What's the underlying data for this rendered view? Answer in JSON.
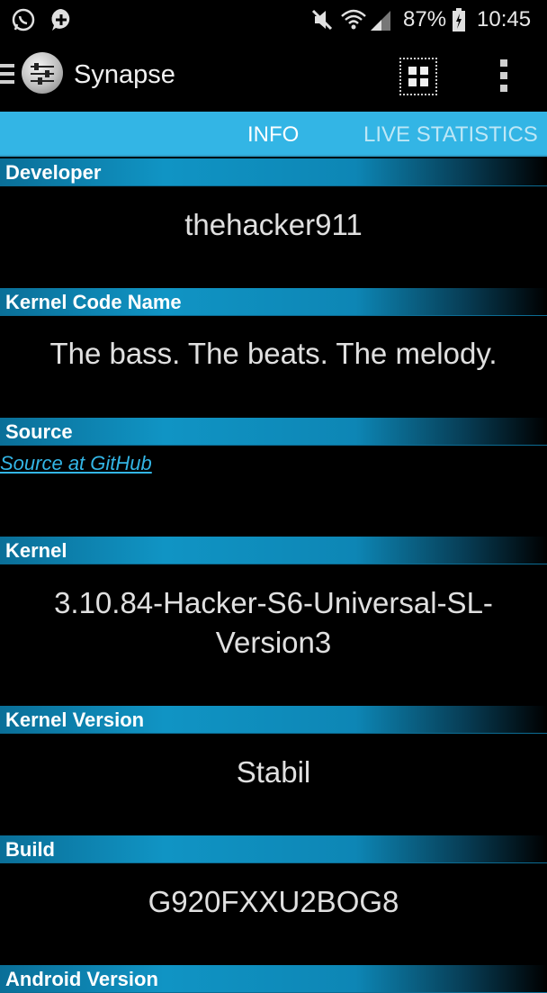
{
  "status_bar": {
    "battery": "87%",
    "time": "10:45",
    "icons": [
      "whatsapp-icon",
      "chat-plus-icon",
      "mute-icon",
      "wifi-icon",
      "signal-icon",
      "battery-icon"
    ]
  },
  "action_bar": {
    "title": "Synapse",
    "icons": [
      "menu-icon",
      "app-logo-icon",
      "grid-icon",
      "overflow-menu-icon"
    ]
  },
  "tabs": [
    {
      "label": "INFO",
      "active": true
    },
    {
      "label": "LIVE STATISTICS",
      "active": false
    }
  ],
  "sections": {
    "developer": {
      "title": "Developer",
      "value": "thehacker911"
    },
    "kernel_code_name": {
      "title": "Kernel Code Name",
      "value": "The bass. The beats. The melody."
    },
    "source": {
      "title": "Source",
      "link": "Source at GitHub"
    },
    "kernel": {
      "title": "Kernel",
      "value_line1": "3.10.84-Hacker-S6-Universal-SL-",
      "value_line2": "Version3"
    },
    "kernel_version": {
      "title": "Kernel Version",
      "value": "Stabil"
    },
    "build": {
      "title": "Build",
      "value": "G920FXXU2BOG8"
    },
    "android_version": {
      "title": "Android Version"
    }
  },
  "colors": {
    "accent": "#33b5e5",
    "header_gradient": "#1094c4",
    "background": "#000000"
  }
}
